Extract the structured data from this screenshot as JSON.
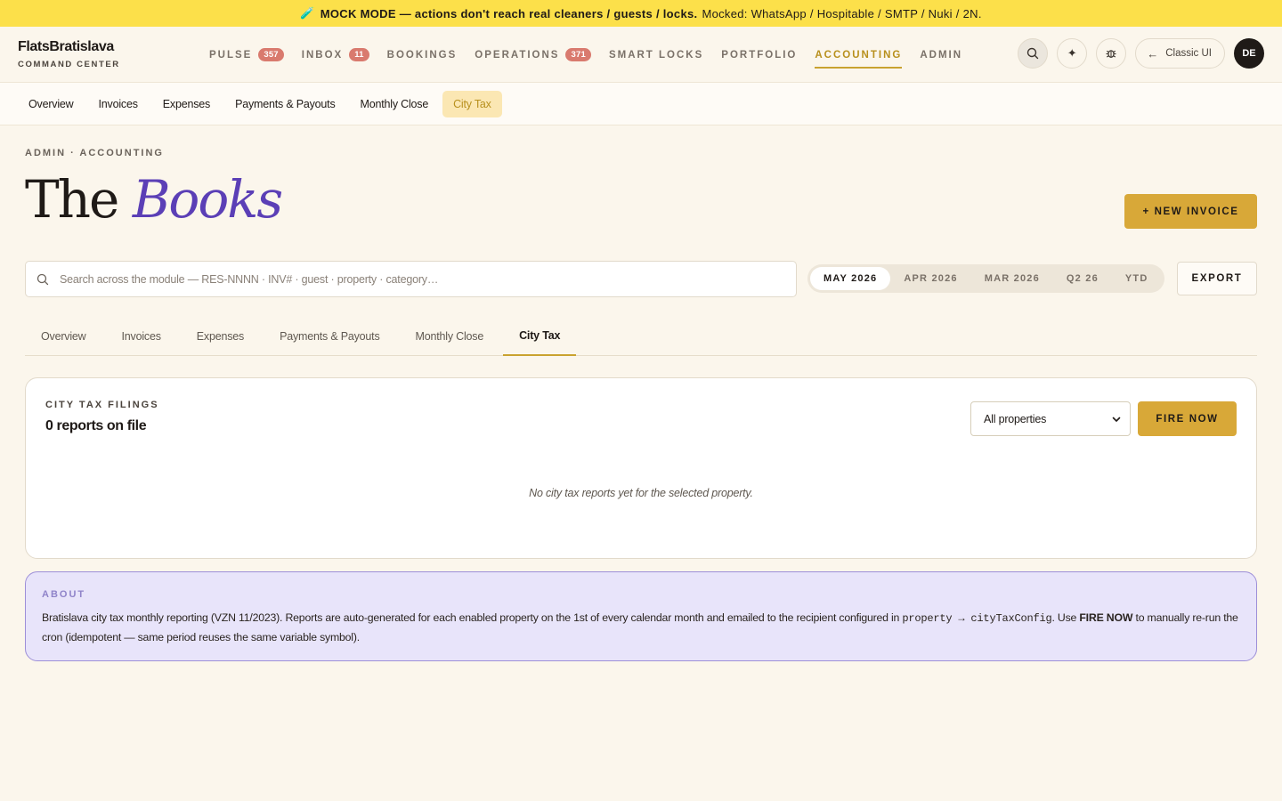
{
  "banner": {
    "emoji": "🧪",
    "strong": "MOCK MODE — actions don't reach real cleaners / guests / locks.",
    "rest": "Mocked: WhatsApp / Hospitable / SMTP / Nuki / 2N."
  },
  "brand": {
    "name": "FlatsBratislava",
    "sub": "COMMAND CENTER"
  },
  "nav": [
    {
      "label": "PULSE",
      "badge": "357"
    },
    {
      "label": "INBOX",
      "badge": "11"
    },
    {
      "label": "BOOKINGS",
      "badge": ""
    },
    {
      "label": "OPERATIONS",
      "badge": "371"
    },
    {
      "label": "SMART LOCKS",
      "badge": ""
    },
    {
      "label": "PORTFOLIO",
      "badge": ""
    },
    {
      "label": "ACCOUNTING",
      "badge": "",
      "active": true
    },
    {
      "label": "ADMIN",
      "badge": ""
    }
  ],
  "nav_right": {
    "classic_label": "Classic UI",
    "avatar_initials": "DE",
    "icons": [
      "search-icon",
      "sparkle-icon",
      "bug-icon"
    ]
  },
  "subnav": [
    "Overview",
    "Invoices",
    "Expenses",
    "Payments & Payouts",
    "Monthly Close",
    "City Tax"
  ],
  "subnav_active": "City Tax",
  "breadcrumb": "ADMIN · ACCOUNTING",
  "title": {
    "plain": "The",
    "accent": "Books"
  },
  "new_invoice_label": "+ NEW INVOICE",
  "search": {
    "placeholder": "Search across the module — RES-NNNN · INV# · guest · property · category…",
    "value": ""
  },
  "periods": [
    "MAY 2026",
    "APR 2026",
    "MAR 2026",
    "Q2 26",
    "YTD"
  ],
  "period_active": "MAY 2026",
  "export_label": "EXPORT",
  "tabs": [
    "Overview",
    "Invoices",
    "Expenses",
    "Payments & Payouts",
    "Monthly Close",
    "City Tax"
  ],
  "tab_active": "City Tax",
  "filings": {
    "label": "CITY TAX FILINGS",
    "count": "0 reports on file",
    "select_value": "All properties",
    "fire_label": "FIRE NOW",
    "empty": "No city tax reports yet for the selected property."
  },
  "about": {
    "label": "ABOUT",
    "text_1": "Bratislava city tax monthly reporting (VZN 11/2023). Reports are auto-generated for each enabled property on the 1st of every calendar month and emailed to the recipient configured in ",
    "code": "property → cityTaxConfig",
    "text_2": ". Use ",
    "bold": "FIRE NOW",
    "text_3": " to manually re-run the cron (idempotent — same period reuses the same variable symbol)."
  },
  "colors": {
    "accent": "#c9a22f",
    "brand_purple": "#5b3fb6",
    "banner": "#fce04a",
    "badge": "#d97a6e"
  }
}
